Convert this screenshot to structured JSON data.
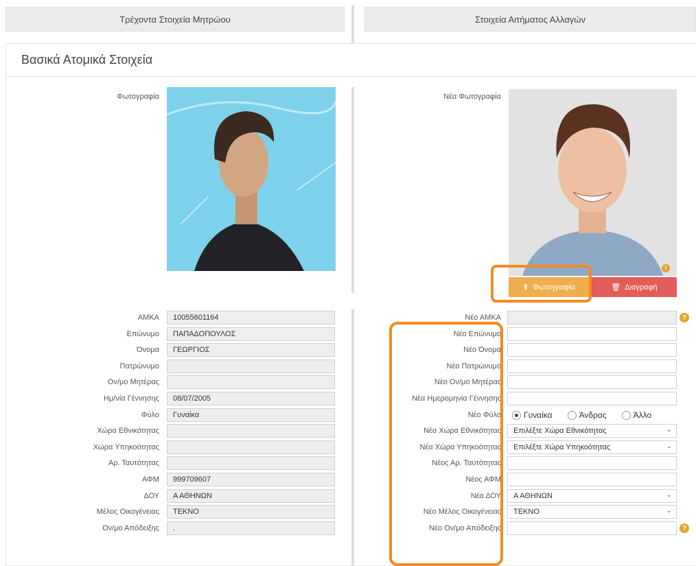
{
  "headers": {
    "current": "Τρέχοντα Στοιχεία Μητρώου",
    "request": "Στοιχεία Αιτήματος Αλλαγών"
  },
  "section": {
    "title": "Βασικά Ατομικά Στοιχεία"
  },
  "photo": {
    "current_label": "Φωτογραφία",
    "new_label": "Νέα Φωτογραφία",
    "upload_button": "Φωτογραφία",
    "delete_button": "Διαγραφή"
  },
  "current_fields": [
    {
      "label": "ΑΜΚΑ",
      "value": "10055601164"
    },
    {
      "label": "Επώνυμο",
      "value": "ΠΑΠΑΔΟΠΟΥΛΟΣ"
    },
    {
      "label": "Όνομα",
      "value": "ΓΕΩΡΓΙΟΣ"
    },
    {
      "label": "Πατρώνυμο",
      "value": ""
    },
    {
      "label": "Ον/μο Μητέρας",
      "value": ""
    },
    {
      "label": "Ημ/νία Γέννησης",
      "value": "08/07/2005"
    },
    {
      "label": "Φύλο",
      "value": "Γυναίκα"
    },
    {
      "label": "Χώρα Εθνικότητας",
      "value": ""
    },
    {
      "label": "Χώρα Υπηκοότητας",
      "value": ""
    },
    {
      "label": "Αρ. Ταυτότητας",
      "value": ""
    },
    {
      "label": "ΑΦΜ",
      "value": "999709607"
    },
    {
      "label": "ΔΟΥ",
      "value": "Α ΑΘΗΝΩΝ"
    },
    {
      "label": "Μέλος Οικογένειας",
      "value": "ΤΕΚΝΟ"
    },
    {
      "label": "Ον/μο Απόδειξης",
      "value": "."
    }
  ],
  "new_fields": [
    {
      "label": "Νέο ΑΜΚΑ",
      "value": ""
    },
    {
      "label": "Νέο Επώνυμο",
      "value": ""
    },
    {
      "label": "Νέο Όνομα",
      "value": ""
    },
    {
      "label": "Νέο Πατρώνυμο",
      "value": ""
    },
    {
      "label": "Νέο Ον/μο Μητέρας",
      "value": ""
    },
    {
      "label": "Νέα Ημερομηνία Γέννησης",
      "value": ""
    },
    {
      "label": "Νέο Φύλο",
      "value": ""
    },
    {
      "label": "Νέα Χώρα Εθνικότητας",
      "value": "Επιλέξτε Χώρα Εθνικότητας"
    },
    {
      "label": "Νέα Χώρα Υπηκοότητας",
      "value": "Επιλέξτε Χώρα Υπηκοότητας"
    },
    {
      "label": "Νέος Αρ. Ταυτότητας",
      "value": ""
    },
    {
      "label": "Νέος ΑΦΜ",
      "value": ""
    },
    {
      "label": "Νέα ΔΟΥ",
      "value": "Α ΑΘΗΝΩΝ"
    },
    {
      "label": "Νέο Μέλος Οικογένειας",
      "value": "ΤΕΚΝΟ"
    },
    {
      "label": "Νέο Ον/μο Απόδειξης",
      "value": ""
    }
  ],
  "gender_options": [
    "Γυναίκα",
    "Άνδρας",
    "Άλλο"
  ],
  "gender_selected": "Γυναίκα",
  "help_icon_text": "?",
  "warning_icon_text": "!",
  "colors": {
    "upload_button": "#f0ad4e",
    "delete_button": "#e35d59",
    "highlight": "#f58a1f",
    "help_icon": "#e7a22c"
  }
}
